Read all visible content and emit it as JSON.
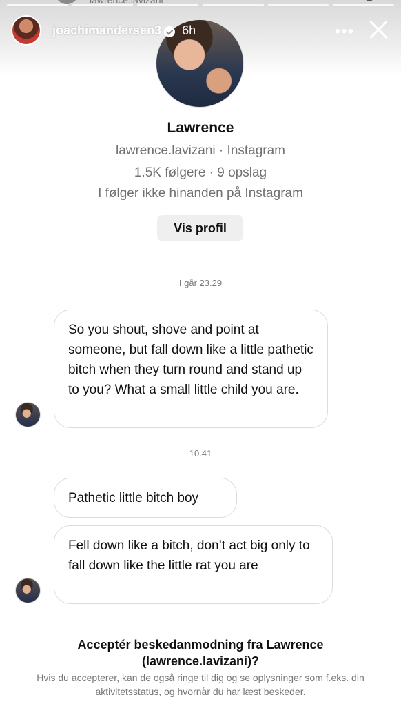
{
  "story": {
    "ghost_username": "lawrence.lavizani",
    "username": "joachimandersen3",
    "time": "6h",
    "more_icon": "more-dots-icon",
    "close_icon": "close-icon"
  },
  "profile": {
    "name": "Lawrence",
    "handle_line": "lawrence.lavizani · Instagram",
    "stats_line": "1.5K følgere · 9 opslag",
    "follow_line": "I følger ikke hinanden på Instagram",
    "view_profile_label": "Vis profil"
  },
  "conversation": {
    "timestamp_1": "I går 23.29",
    "timestamp_2": "10.41",
    "messages": [
      {
        "text": "So you shout, shove and point at someone, but fall down like a little pathetic bitch when they turn round and stand up to you? What a small little child you are."
      },
      {
        "text": "Pathetic little bitch boy"
      },
      {
        "text": "Fell down like a bitch, don’t act big only to fall down like the little rat you are"
      }
    ]
  },
  "request": {
    "title_line1": "Acceptér beskedanmodning fra Lawrence",
    "title_line2": "(lawrence.lavizani)?",
    "description": "Hvis du accepterer, kan de også ringe til dig og se oplysninger som f.eks. din aktivitetsstatus, og hvornår du har læst beskeder."
  }
}
